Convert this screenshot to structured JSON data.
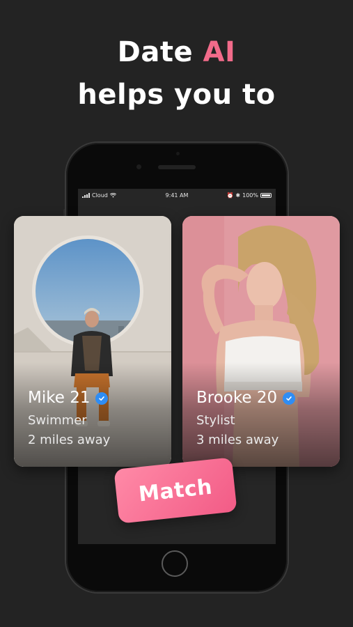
{
  "headline": {
    "line1_prefix": "Date",
    "line1_accent": "AI",
    "line2": "helps you to"
  },
  "statusbar": {
    "carrier": "Cloud",
    "time": "9:41 AM",
    "battery": "100%"
  },
  "cards": [
    {
      "name": "Mike",
      "age": "21",
      "occupation": "Swimmer",
      "distance": "2 miles away",
      "verified": true
    },
    {
      "name": "Brooke",
      "age": "20",
      "occupation": "Stylist",
      "distance": "3 miles away",
      "verified": true
    }
  ],
  "match_button": {
    "label": "Match"
  },
  "colors": {
    "background": "#232323",
    "accent": "#f26b8a",
    "verified_badge": "#2f8df4",
    "match_gradient_start": "#ff8aa7",
    "match_gradient_end": "#f25b86"
  }
}
